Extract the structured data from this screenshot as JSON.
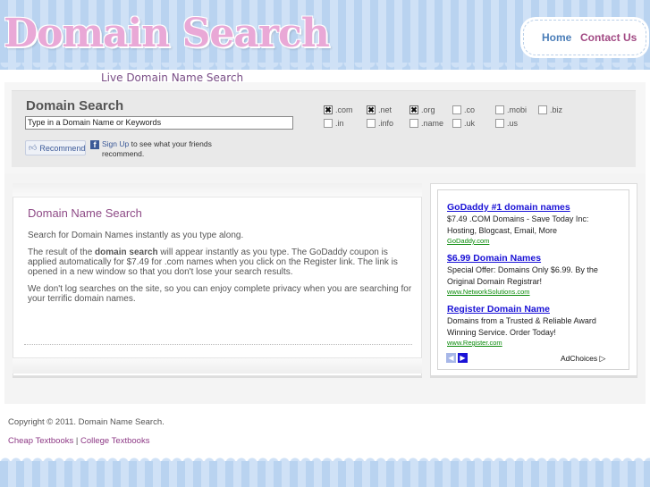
{
  "site": {
    "logo_text": "Domain Search",
    "tagline": "Live Domain Name Search"
  },
  "nav": {
    "home_label": "Home",
    "contact_label": "Contact Us"
  },
  "search": {
    "title": "Domain Search",
    "input_value": "Type in a Domain Name or Keywords",
    "tlds": [
      {
        "label": ".com",
        "checked": true
      },
      {
        "label": ".net",
        "checked": true
      },
      {
        "label": ".org",
        "checked": true
      },
      {
        "label": ".co",
        "checked": false
      },
      {
        "label": ".mobi",
        "checked": false
      },
      {
        "label": ".biz",
        "checked": false
      },
      {
        "label": ".in",
        "checked": false
      },
      {
        "label": ".info",
        "checked": false
      },
      {
        "label": ".name",
        "checked": false
      },
      {
        "label": ".uk",
        "checked": false
      },
      {
        "label": ".us",
        "checked": false
      }
    ],
    "check_glyph": "✖",
    "recommend_label": "Recommend",
    "signup_link": "Sign Up",
    "signup_rest": " to see what your friends recommend."
  },
  "content": {
    "heading": "Domain Name Search",
    "p1": "Search for Domain Names instantly as you type along.",
    "p2_a": "The result of the ",
    "p2_bold": "domain search",
    "p2_b": " will appear instantly as you type. The GoDaddy coupon is applied automatically for $7.49 for .com names when you click on the Register link. The link is opened in a new window so that you don't lose your search results.",
    "p3": "We don't log searches on the site, so you can enjoy complete privacy when you are searching for your terrific domain names."
  },
  "ads": {
    "items": [
      {
        "title": "GoDaddy #1 domain names",
        "body": "$7.49 .COM Domains - Save Today Inc: Hosting, Blogcast, Email, More",
        "url": "GoDaddy.com"
      },
      {
        "title": "$6.99 Domain Names",
        "body": "Special Offer: Domains Only $6.99. By the Original Domain Registrar!",
        "url": "www.NetworkSolutions.com"
      },
      {
        "title": "Register Domain Name",
        "body": "Domains from a Trusted & Reliable Award Winning Service. Order Today!",
        "url": "www.Register.com"
      }
    ],
    "adchoices_label": "AdChoices"
  },
  "footer": {
    "copyright": "Copyright © 2011. Domain Name Search.",
    "link1": "Cheap Textbooks",
    "separator": " | ",
    "link2": "College Textbooks"
  }
}
